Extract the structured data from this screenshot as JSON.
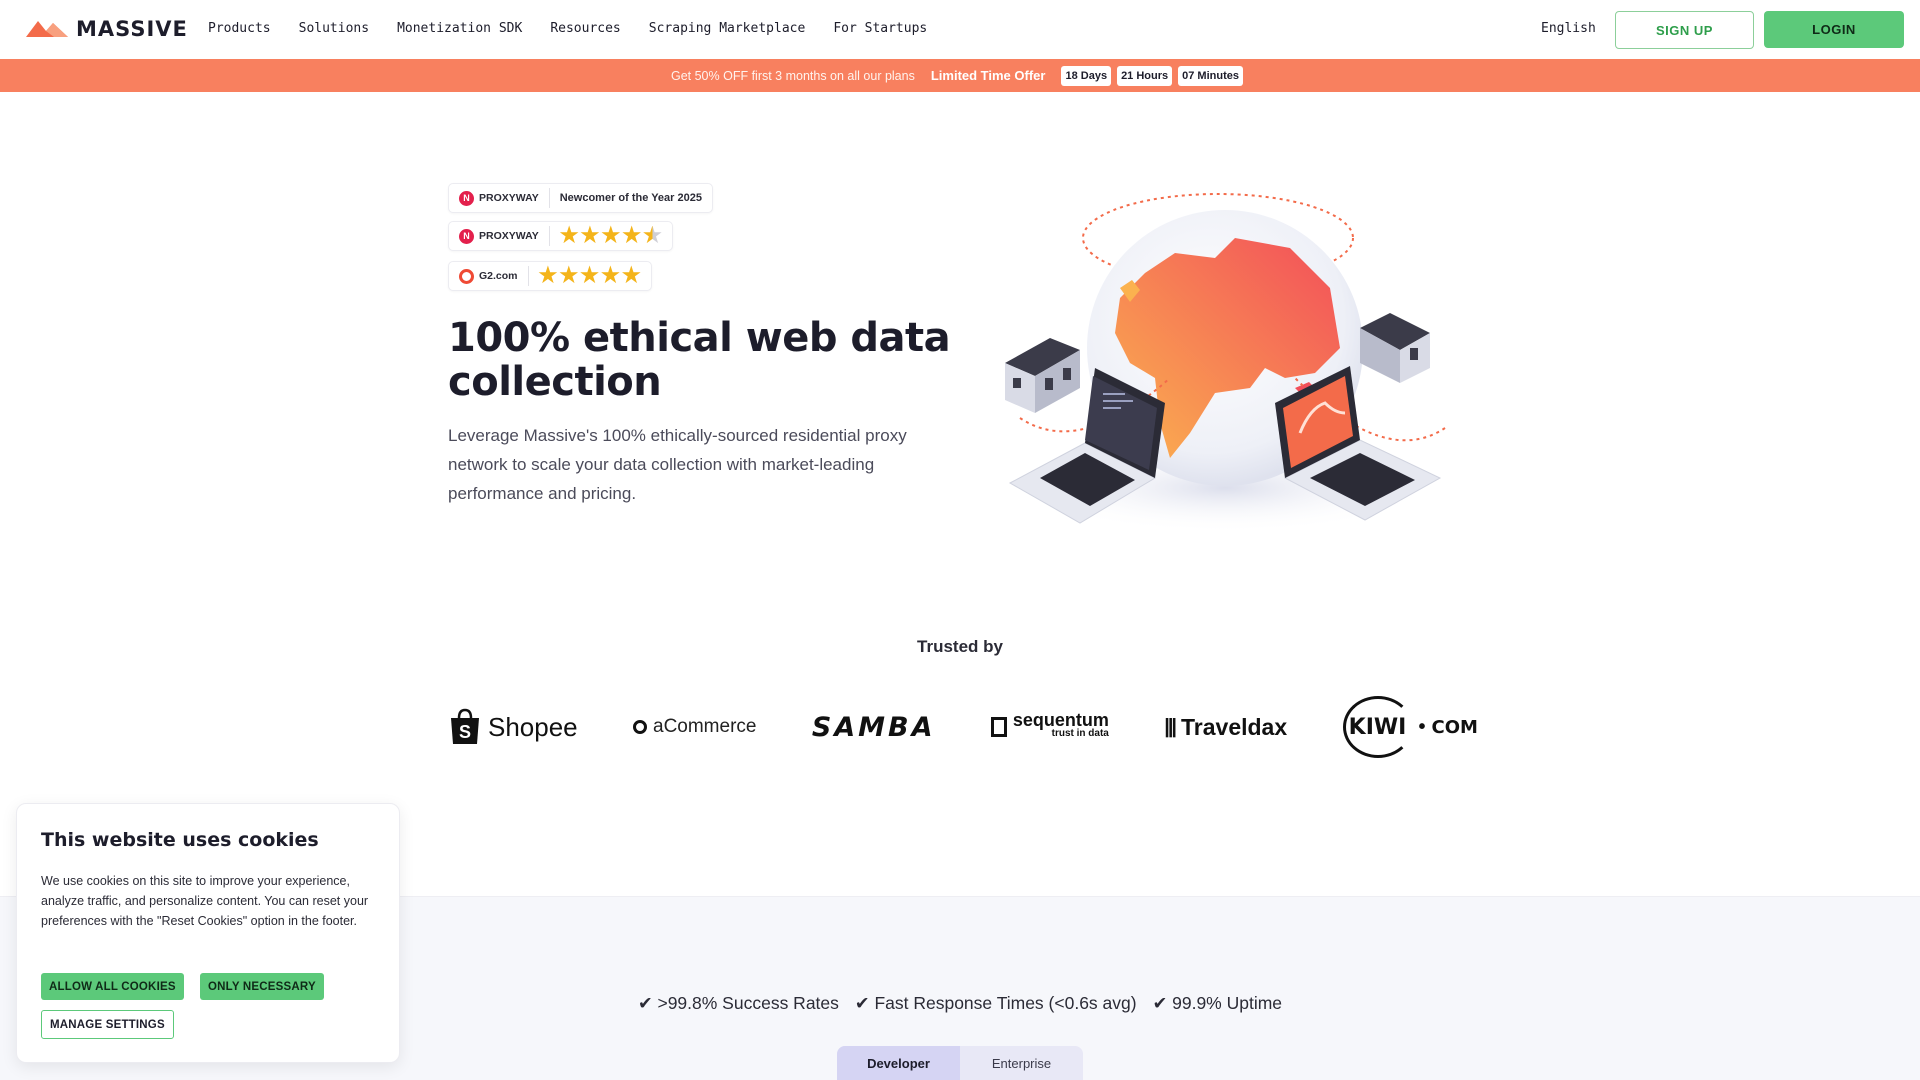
{
  "brand": {
    "name": "MASSIVE",
    "accent": "#5cc97a",
    "promo_color": "#f8805f",
    "logo_color": "#f36b4a"
  },
  "nav": {
    "items": [
      "Products",
      "Solutions",
      "Monetization SDK",
      "Resources",
      "Scraping Marketplace",
      "For Startups"
    ],
    "language": "English",
    "signup": "SIGN UP",
    "login": "LOGIN"
  },
  "promo": {
    "text": "Get 50% OFF first 3 months on all our plans",
    "highlight": "Limited Time Offer",
    "countdown": [
      "18 Days",
      "21 Hours",
      "07 Minutes"
    ]
  },
  "badges": [
    {
      "brand": "PROXYWAY",
      "text": "Newcomer of the Year 2025"
    },
    {
      "brand": "PROXYWAY",
      "rating": 4.5
    },
    {
      "brand": "G2.com",
      "rating": 5
    }
  ],
  "hero": {
    "title": "100% ethical web data collection",
    "subtitle": "Leverage Massive's 100% ethically-sourced residential proxy network to scale your data collection with market-leading performance and pricing."
  },
  "trusted": {
    "title": "Trusted by",
    "logos": [
      "Shopee",
      "aCommerce",
      "SAMBA",
      "sequentum",
      "trust in data",
      "Traveldax",
      "KIWI",
      "COM"
    ]
  },
  "cookies": {
    "title": "This website uses cookies",
    "body": "We use cookies on this site to improve your experience, analyze traffic, and personalize content. You can reset your preferences with the \"Reset Cookies\" option in the footer.",
    "allow_all": "ALLOW ALL COOKIES",
    "only_necessary": "ONLY NECESSARY",
    "manage": "MANAGE SETTINGS"
  },
  "stats": [
    ">99.8% Success Rates",
    "Fast Response Times (<0.6s avg)",
    "99.9% Uptime"
  ],
  "stats_mark": "✔",
  "tabs": [
    "Developer",
    "Enterprise"
  ]
}
